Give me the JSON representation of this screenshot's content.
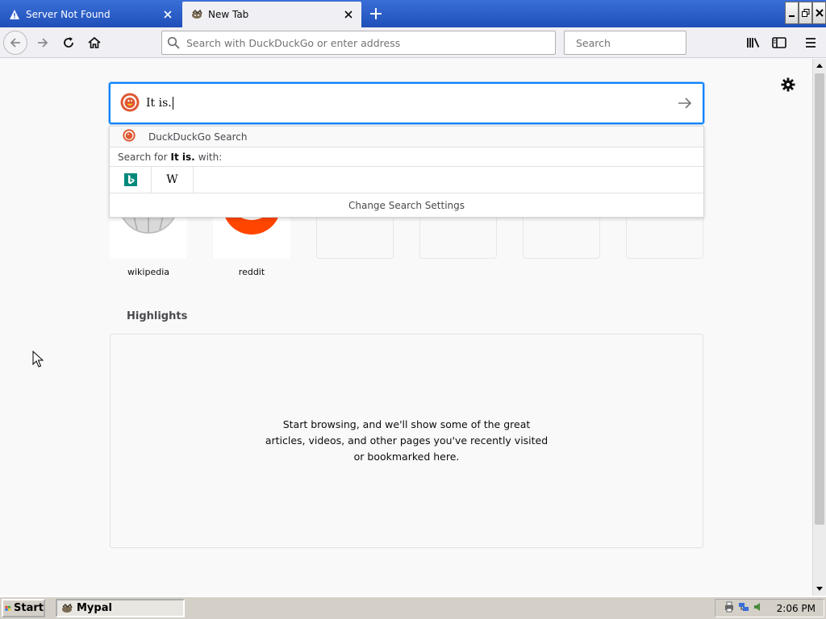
{
  "tabs": [
    {
      "label": "Server Not Found",
      "active": false,
      "icon": "warning-icon"
    },
    {
      "label": "New Tab",
      "active": true,
      "icon": "mypal-icon"
    }
  ],
  "navbar": {
    "url_placeholder": "Search with DuckDuckGo or enter address",
    "search_placeholder": "Search"
  },
  "hero_search": {
    "typed": "It is."
  },
  "suggestions": {
    "engine_label": "DuckDuckGo Search",
    "search_for_prefix": "Search for",
    "search_term": "It is.",
    "search_for_suffix": "with:",
    "engines": [
      "bing-icon",
      "wikipedia-icon"
    ],
    "wiki_letter": "W",
    "settings_label": "Change Search Settings"
  },
  "topsites": [
    {
      "label": "wikipedia"
    },
    {
      "label": "reddit"
    }
  ],
  "highlights": {
    "title": "Highlights",
    "empty_message": "Start browsing, and we'll show some of the great articles, videos, and other pages you've recently visited or bookmarked here."
  },
  "taskbar": {
    "start_label": "Start",
    "task_label": "Mypal",
    "clock": "2:06 PM"
  },
  "colors": {
    "accent": "#0a84ff",
    "reddit": "#ff4500",
    "tabstrip": "#2a5fcc"
  }
}
